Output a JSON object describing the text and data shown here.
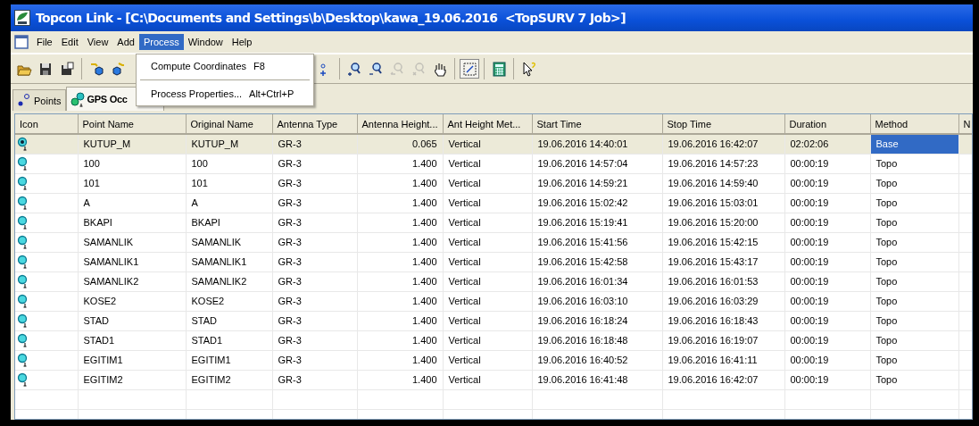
{
  "window": {
    "title": "Topcon Link - [C:\\Documents and Settings\\b\\Desktop\\kawa_19.06.2016  <TopSURV 7 Job>]"
  },
  "menu": [
    {
      "label": "File",
      "selected": false
    },
    {
      "label": "Edit",
      "selected": false
    },
    {
      "label": "View",
      "selected": false
    },
    {
      "label": "Add",
      "selected": false
    },
    {
      "label": "Process",
      "selected": true
    },
    {
      "label": "Window",
      "selected": false
    },
    {
      "label": "Help",
      "selected": false
    }
  ],
  "open_menu": {
    "items": [
      {
        "label": "Compute Coordinates",
        "shortcut": "F8"
      },
      {
        "label": "Process Properties...",
        "shortcut": "Alt+Ctrl+P"
      }
    ]
  },
  "toolbar": [
    {
      "kind": "open",
      "disabled": false
    },
    {
      "kind": "save",
      "disabled": false
    },
    {
      "kind": "saveas",
      "disabled": false
    },
    {
      "kind": "sep"
    },
    {
      "kind": "import",
      "disabled": false
    },
    {
      "kind": "export",
      "disabled": false
    },
    {
      "kind": "hidden"
    },
    {
      "kind": "addpoint",
      "disabled": false
    },
    {
      "kind": "sep"
    },
    {
      "kind": "zoomin",
      "disabled": false
    },
    {
      "kind": "zoomout",
      "disabled": false
    },
    {
      "kind": "zoomprev",
      "disabled": true
    },
    {
      "kind": "zoomx",
      "disabled": true
    },
    {
      "kind": "pan",
      "disabled": false
    },
    {
      "kind": "sep"
    },
    {
      "kind": "select",
      "disabled": false
    },
    {
      "kind": "sep"
    },
    {
      "kind": "calc",
      "disabled": false
    },
    {
      "kind": "sep"
    },
    {
      "kind": "help",
      "disabled": false
    }
  ],
  "tabs": [
    {
      "label": "Points",
      "kind": "points",
      "selected": false
    },
    {
      "label": "GPS Occ",
      "kind": "gps",
      "selected": true
    }
  ],
  "table": {
    "icon_column": "Icon",
    "columns": [
      "Point Name",
      "Original Name",
      "Antenna Type",
      "Antenna Height...",
      "Ant Height Met...",
      "Start Time",
      "Stop Time",
      "Duration",
      "Method",
      "N"
    ],
    "rows": [
      {
        "kind": "base",
        "selected": true,
        "cells": [
          "KUTUP_M",
          "KUTUP_M",
          "GR-3",
          "0.065",
          "Vertical",
          "19.06.2016 14:40:01",
          "19.06.2016 16:42:07",
          "02:02:06",
          "Base"
        ]
      },
      {
        "kind": "rover",
        "selected": false,
        "cells": [
          "100",
          "100",
          "GR-3",
          "1.400",
          "Vertical",
          "19.06.2016 14:57:04",
          "19.06.2016 14:57:23",
          "00:00:19",
          "Topo"
        ]
      },
      {
        "kind": "rover",
        "selected": false,
        "cells": [
          "101",
          "101",
          "GR-3",
          "1.400",
          "Vertical",
          "19.06.2016 14:59:21",
          "19.06.2016 14:59:40",
          "00:00:19",
          "Topo"
        ]
      },
      {
        "kind": "rover",
        "selected": false,
        "cells": [
          "A",
          "A",
          "GR-3",
          "1.400",
          "Vertical",
          "19.06.2016 15:02:42",
          "19.06.2016 15:03:01",
          "00:00:19",
          "Topo"
        ]
      },
      {
        "kind": "rover",
        "selected": false,
        "cells": [
          "BKAPI",
          "BKAPI",
          "GR-3",
          "1.400",
          "Vertical",
          "19.06.2016 15:19:41",
          "19.06.2016 15:20:00",
          "00:00:19",
          "Topo"
        ]
      },
      {
        "kind": "rover",
        "selected": false,
        "cells": [
          "SAMANLIK",
          "SAMANLIK",
          "GR-3",
          "1.400",
          "Vertical",
          "19.06.2016 15:41:56",
          "19.06.2016 15:42:15",
          "00:00:19",
          "Topo"
        ]
      },
      {
        "kind": "rover",
        "selected": false,
        "cells": [
          "SAMANLIK1",
          "SAMANLIK1",
          "GR-3",
          "1.400",
          "Vertical",
          "19.06.2016 15:42:58",
          "19.06.2016 15:43:17",
          "00:00:19",
          "Topo"
        ]
      },
      {
        "kind": "rover",
        "selected": false,
        "cells": [
          "SAMANLIK2",
          "SAMANLIK2",
          "GR-3",
          "1.400",
          "Vertical",
          "19.06.2016 16:01:34",
          "19.06.2016 16:01:53",
          "00:00:19",
          "Topo"
        ]
      },
      {
        "kind": "rover",
        "selected": false,
        "cells": [
          "KOSE2",
          "KOSE2",
          "GR-3",
          "1.400",
          "Vertical",
          "19.06.2016 16:03:10",
          "19.06.2016 16:03:29",
          "00:00:19",
          "Topo"
        ]
      },
      {
        "kind": "rover",
        "selected": false,
        "cells": [
          "STAD",
          "STAD",
          "GR-3",
          "1.400",
          "Vertical",
          "19.06.2016 16:18:24",
          "19.06.2016 16:18:43",
          "00:00:19",
          "Topo"
        ]
      },
      {
        "kind": "rover",
        "selected": false,
        "cells": [
          "STAD1",
          "STAD1",
          "GR-3",
          "1.400",
          "Vertical",
          "19.06.2016 16:18:48",
          "19.06.2016 16:19:07",
          "00:00:19",
          "Topo"
        ]
      },
      {
        "kind": "rover",
        "selected": false,
        "cells": [
          "EGITIM1",
          "EGITIM1",
          "GR-3",
          "1.400",
          "Vertical",
          "19.06.2016 16:40:52",
          "19.06.2016 16:41:11",
          "00:00:19",
          "Topo"
        ]
      },
      {
        "kind": "rover",
        "selected": false,
        "cells": [
          "EGITIM2",
          "EGITIM2",
          "GR-3",
          "1.400",
          "Vertical",
          "19.06.2016 16:41:48",
          "19.06.2016 16:42:07",
          "00:00:19",
          "Topo"
        ]
      }
    ]
  }
}
